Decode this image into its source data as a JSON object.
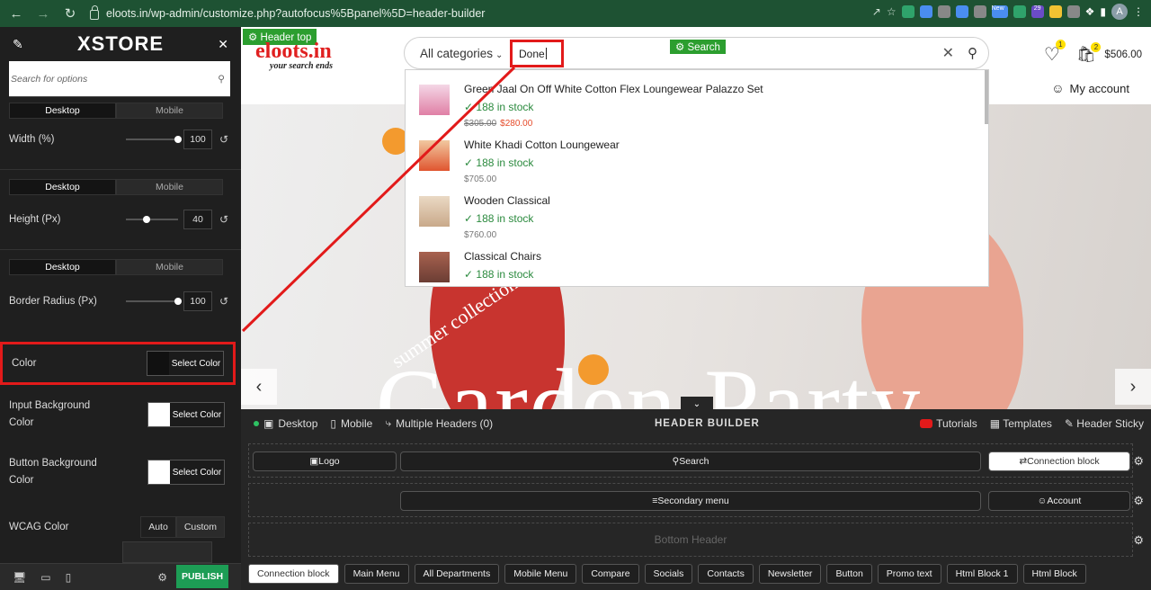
{
  "browser": {
    "url": "eloots.in/wp-admin/customize.php?autofocus%5Bpanel%5D=header-builder",
    "avatar_letter": "A",
    "ext_badge": "29",
    "ext_new": "New"
  },
  "panel": {
    "logo": "XSTORE",
    "search_placeholder": "Search for options",
    "device_tabs": [
      "Desktop",
      "Mobile"
    ],
    "width_label": "Width (%)",
    "width_value": "100",
    "height_label": "Height (Px)",
    "height_value": "40",
    "radius_label": "Border Radius (Px)",
    "radius_value": "100",
    "color_label": "Color",
    "select_color": "Select Color",
    "input_bg_label": "Input Background Color",
    "button_bg_label": "Button Background Color",
    "wcag_label": "WCAG Color",
    "wcag_auto": "Auto",
    "wcag_custom": "Custom",
    "publish": "PUBLISH",
    "colors": {
      "color": "#111111",
      "input_bg": "#ffffff",
      "button_bg": "#ffffff"
    },
    "slider_levels": {
      "width": 1.0,
      "height": 0.4,
      "radius": 1.0
    }
  },
  "site": {
    "header_top_tag": "Header top",
    "logo_main": "eloots.in",
    "logo_tagline": "your search ends",
    "categories_label": "All categories",
    "search_value": "Done",
    "search_tag": "Search",
    "wishlist_count": "1",
    "cart_count": "2",
    "cart_total": "$506.00",
    "my_account": "My account",
    "hero_subtitle": "summer collection",
    "hero_title": "Garden Party",
    "results": [
      {
        "name": "Green Jaal On Off White Cotton Flex Loungewear Palazzo Set",
        "stock": "188 in stock",
        "old_price": "$305.00",
        "price": "$280.00"
      },
      {
        "name": "White Khadi Cotton Loungewear",
        "stock": "188 in stock",
        "old_price": "",
        "price": "$705.00"
      },
      {
        "name": "Wooden Classical",
        "stock": "188 in stock",
        "old_price": "",
        "price": "$760.00"
      },
      {
        "name": "Classical Chairs",
        "stock": "188 in stock",
        "old_price": "",
        "price": ""
      }
    ]
  },
  "builder": {
    "desktop": "Desktop",
    "mobile": "Mobile",
    "multiple": "Multiple Headers (0)",
    "title": "HEADER BUILDER",
    "tutorials": "Tutorials",
    "templates": "Templates",
    "sticky": "Header Sticky",
    "row1": {
      "logo": "Logo",
      "search": "Search",
      "connection": "Connection block"
    },
    "row2": {
      "secondary": "Secondary menu",
      "account": "Account"
    },
    "row3": "Bottom Header",
    "elements": [
      "Connection block",
      "Main Menu",
      "All Departments",
      "Mobile Menu",
      "Compare",
      "Socials",
      "Contacts",
      "Newsletter",
      "Button",
      "Promo text",
      "Html Block 1",
      "Html Block"
    ]
  },
  "accent": {
    "red": "#e21a1a",
    "green": "#2c9e2f",
    "chrome": "#1e5233"
  }
}
